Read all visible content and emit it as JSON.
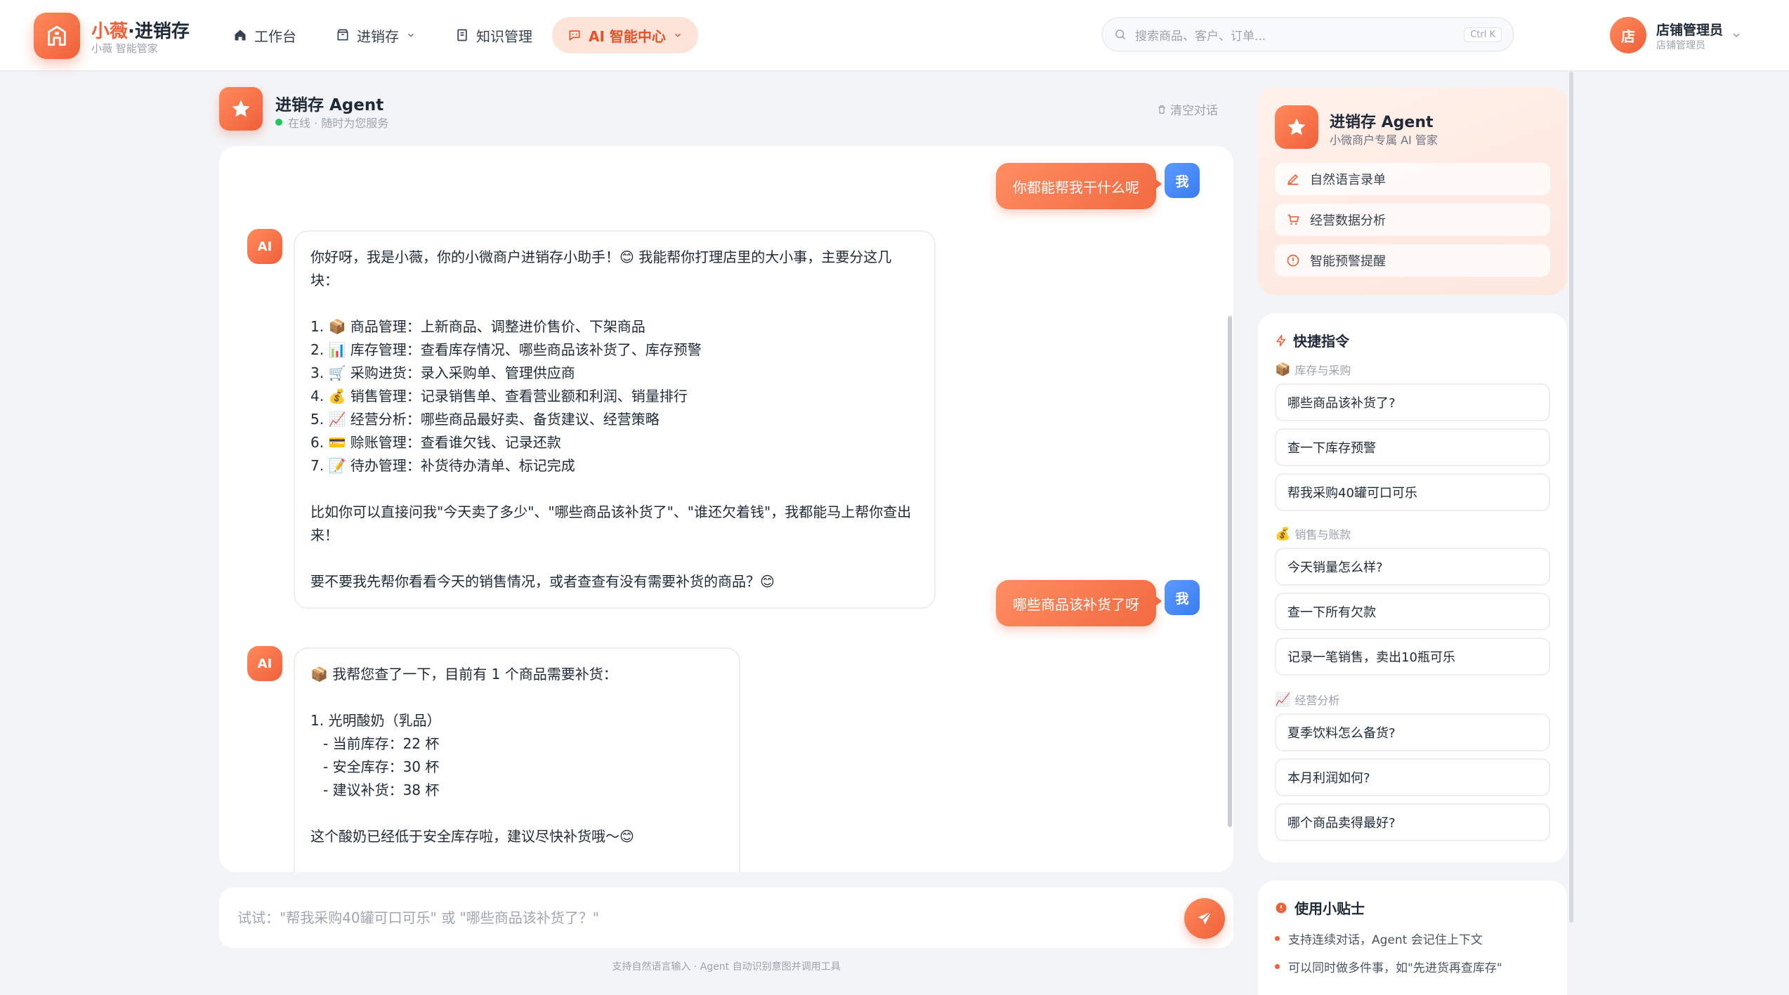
{
  "app": {
    "name_main": "小薇",
    "name_sep": "·进销存",
    "subtitle": "小薇 智能管家"
  },
  "nav": [
    {
      "label": "工作台",
      "icon": "home-icon"
    },
    {
      "label": "进销存",
      "icon": "box-icon"
    },
    {
      "label": "知识管理",
      "icon": "book-icon"
    },
    {
      "label": "AI 智能中心",
      "icon": "chat-icon"
    }
  ],
  "search": {
    "placeholder": "搜索商品、客户、订单...",
    "shortcut": "Ctrl K"
  },
  "user": {
    "avatar": "店",
    "name": "店铺管理员",
    "role": "店铺管理员"
  },
  "chat": {
    "agent_name": "进销存 Agent",
    "status": "在线 · 随时为您服务",
    "clear_label": "清空对话",
    "user_avatar": "我",
    "ai_avatar": "AI",
    "messages": {
      "q1": "你都能帮我干什么呢",
      "a1": {
        "intro": "你好呀，我是小薇，你的小微商户进销存小助手！😊 我能帮你打理店里的大小事，主要分这几块：",
        "items": [
          "1. 📦 商品管理：上新商品、调整进价售价、下架商品",
          "2. 📊 库存管理：查看库存情况、哪些商品该补货了、库存预警",
          "3. 🛒 采购进货：录入采购单、管理供应商",
          "4. 💰 销售管理：记录销售单、查看营业额和利润、销量排行",
          "5. 📈 经营分析：哪些商品最好卖、备货建议、经营策略",
          "6. 💳 赊账管理：查看谁欠钱、记录还款",
          "7. 📝 待办管理：补货待办清单、标记完成"
        ],
        "example": "比如你可以直接问我\"今天卖了多少\"、\"哪些商品该补货了\"、\"谁还欠着钱\"，我都能马上帮你查出来！",
        "closing": "要不要我先帮你看看今天的销售情况，或者查查有没有需要补货的商品？😊"
      },
      "q2": "哪些商品该补货了呀",
      "a2": {
        "intro": "📦 我帮您查了一下，目前有 1 个商品需要补货：",
        "item_title": "1. 光明酸奶（乳品）",
        "details": [
          "- 当前库存：22 杯",
          "- 安全库存：30 杯",
          "- 建议补货：38 杯"
        ],
        "closing": "这个酸奶已经低于安全库存啦，建议尽快补货哦～😊"
      }
    },
    "input_placeholder": "试试：\"帮我采购40罐可口可乐\" 或 \"哪些商品该补货了？\"",
    "footnote": "支持自然语言输入 · Agent 自动识别意图并调用工具"
  },
  "sidebar": {
    "agent_card": {
      "title": "进销存 Agent",
      "subtitle": "小微商户专属 AI 管家",
      "features": [
        "自然语言录单",
        "经营数据分析",
        "智能预警提醒"
      ]
    },
    "quick": {
      "title": "快捷指令",
      "groups": [
        {
          "label": "库存与采购",
          "items": [
            "哪些商品该补货了?",
            "查一下库存预警",
            "帮我采购40罐可口可乐"
          ]
        },
        {
          "label": "销售与账款",
          "items": [
            "今天销量怎么样?",
            "查一下所有欠款",
            "记录一笔销售，卖出10瓶可乐"
          ]
        },
        {
          "label": "经营分析",
          "items": [
            "夏季饮料怎么备货?",
            "本月利润如何?",
            "哪个商品卖得最好?"
          ]
        }
      ]
    },
    "tips": {
      "title": "使用小贴士",
      "items": [
        "支持连续对话，Agent 会记住上下文",
        "可以同时做多件事，如\"先进货再查库存\""
      ]
    }
  },
  "colors": {
    "accent": "#f0603a",
    "user_avatar": "#3b7cf0",
    "online": "#22c55e"
  }
}
